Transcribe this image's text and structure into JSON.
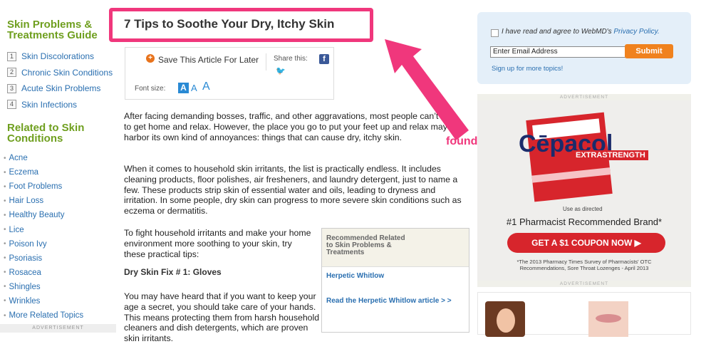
{
  "left": {
    "guide_title": "Skin Problems & Treatments Guide",
    "guide_items": [
      {
        "num": "1",
        "label": "Skin Discolorations"
      },
      {
        "num": "2",
        "label": "Chronic Skin Conditions"
      },
      {
        "num": "3",
        "label": "Acute Skin Problems"
      },
      {
        "num": "4",
        "label": "Skin Infections"
      }
    ],
    "related_title": "Related to Skin Conditions",
    "conditions": [
      "Acne",
      "Eczema",
      "Foot Problems",
      "Hair Loss",
      "Healthy Beauty",
      "Lice",
      "Poison Ivy",
      "Psoriasis",
      "Rosacea",
      "Shingles",
      "Wrinkles",
      "More Related Topics"
    ],
    "ad_label": "ADVERTISEMENT"
  },
  "article": {
    "title": "7 Tips to Soothe Your Dry, Itchy Skin",
    "save_label": "Save This Article For Later",
    "share_label": "Share this:",
    "font_size_label": "Font size:",
    "font_sizes": [
      "A",
      "A",
      "A"
    ],
    "paragraphs": [
      "After facing demanding bosses, traffic, and other aggravations, most people can’t wait to get home and relax. However, the place you go to put your feet up and relax may harbor its own kind of annoyances: things that can cause dry, itchy skin.",
      "When it comes to household skin irritants, the list is practically endless. It includes cleaning products, floor polishes, air fresheners, and laundry detergent, just to name a few. These products strip skin of essential water and oils, leading to dryness and irritation. In some people, dry skin can progress to more severe skin conditions such as eczema or dermatitis.",
      "To fight household irritants and make your home environment more soothing to your skin, try these practical tips:",
      "You may have heard that if you want to keep your age a secret, you should take care of your hands. This means protecting them from harsh household cleaners and dish detergents, which are proven skin irritants."
    ],
    "fix_title": "Dry Skin Fix # 1: Gloves",
    "recommended": {
      "heading": "Recommended Related to Skin Problems & Treatments",
      "link_title": "Herpetic Whitlow",
      "link_more": "Read the Herpetic Whitlow article > >"
    }
  },
  "annotation": {
    "text": "found it!",
    "color": "#f0377c"
  },
  "right": {
    "agree_text": "I have read and agree to WebMD's ",
    "privacy_link": "Privacy Policy.",
    "email_value": "Enter Email Address",
    "submit_label": "Submit",
    "more_topics": "Sign up for more topics!",
    "ad_label": "ADVERTISEMENT",
    "ad": {
      "brand": "Cēpacol",
      "extra": "EXTRASTRENGTH",
      "use": "Use as directed",
      "claim": "#1 Pharmacist Recommended Brand*",
      "coupon": "GET A $1 COUPON NOW",
      "fine": "*The 2013 Pharmacy Times Survey of Pharmacists' OTC Recommendations, Sore Throat Lozenges - April 2013"
    },
    "ad_label_bottom": "ADVERTISEMENT"
  }
}
